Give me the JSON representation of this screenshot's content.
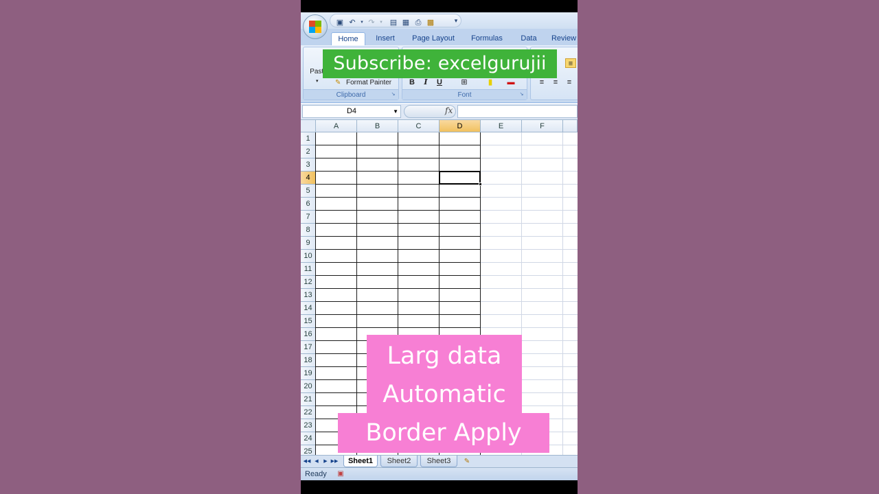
{
  "window": {
    "tabs": [
      {
        "label": "Home",
        "active": true
      },
      {
        "label": "Insert"
      },
      {
        "label": "Page Layout"
      },
      {
        "label": "Formulas"
      },
      {
        "label": "Data"
      },
      {
        "label": "Review"
      }
    ]
  },
  "ribbon": {
    "clipboard": {
      "paste_label": "Paste",
      "format_painter_label": "Format Painter",
      "group_label": "Clipboard"
    },
    "font": {
      "bold": "B",
      "italic": "I",
      "underline": "U",
      "group_label": "Font"
    }
  },
  "overlays": {
    "subscribe": "Subscribe: excelgurujii",
    "line1": "Larg data",
    "line2": "Automatic",
    "line3": "Border Apply"
  },
  "formula_bar": {
    "name_box": "D4",
    "fx": "fx",
    "formula": ""
  },
  "grid": {
    "columns": [
      "A",
      "B",
      "C",
      "D",
      "E",
      "F"
    ],
    "rows": [
      "1",
      "2",
      "3",
      "4",
      "5",
      "6",
      "7",
      "8",
      "9",
      "10",
      "11",
      "12",
      "13",
      "14",
      "15",
      "16",
      "17",
      "18",
      "19",
      "20",
      "21",
      "22",
      "23",
      "24",
      "25"
    ],
    "selected_column": "D",
    "selected_row": "4",
    "active_cell": "D4"
  },
  "sheets": [
    {
      "label": "Sheet1",
      "active": true
    },
    {
      "label": "Sheet2"
    },
    {
      "label": "Sheet3"
    }
  ],
  "status": {
    "text": "Ready"
  },
  "colors": {
    "background": "#8e5f80",
    "subscribe_bg": "#3fb33a",
    "overlay_bg": "#f77fd4",
    "selection_header": "#f1c15f"
  }
}
